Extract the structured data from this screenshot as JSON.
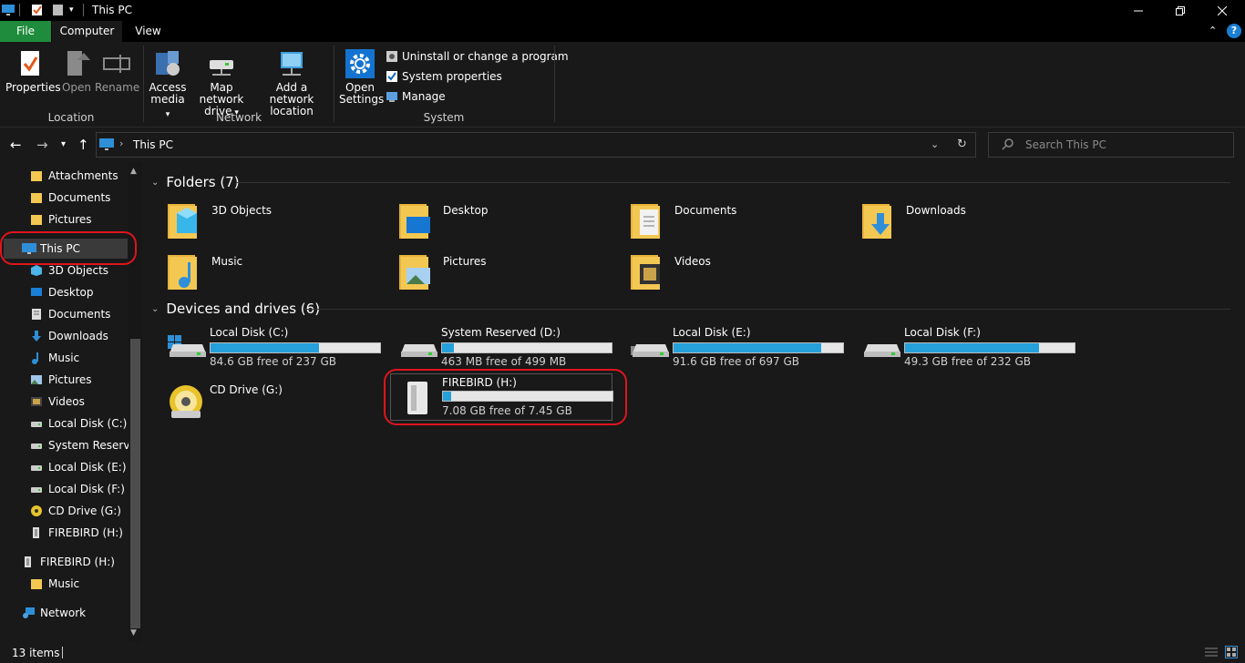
{
  "window": {
    "title": "This PC"
  },
  "ribbon_tabs": [
    {
      "label": "File",
      "active": false,
      "color": "#1e8c3c"
    },
    {
      "label": "Computer",
      "active": true
    },
    {
      "label": "View",
      "active": false
    }
  ],
  "ribbon": {
    "location": {
      "label": "Location",
      "buttons": [
        "Properties",
        "Open",
        "Rename"
      ]
    },
    "network": {
      "label": "Network",
      "access_media": [
        "Access",
        "media"
      ],
      "map_drive": [
        "Map network",
        "drive"
      ],
      "add_location": [
        "Add a network",
        "location"
      ]
    },
    "system": {
      "label": "System",
      "open_settings": [
        "Open",
        "Settings"
      ],
      "uninstall": "Uninstall or change a program",
      "properties": "System properties",
      "manage": "Manage"
    }
  },
  "address": {
    "path": "This PC"
  },
  "search": {
    "placeholder": "Search This PC"
  },
  "nav_pane": [
    {
      "label": "Attachments",
      "icon": "folder-icon",
      "indent": 1
    },
    {
      "label": "Documents",
      "icon": "folder-icon",
      "indent": 1
    },
    {
      "label": "Pictures",
      "icon": "folder-icon",
      "indent": 1
    },
    {
      "label": "This PC",
      "icon": "computer-icon",
      "indent": 0,
      "selected": true
    },
    {
      "label": "3D Objects",
      "icon": "3d-objects-icon",
      "indent": 1
    },
    {
      "label": "Desktop",
      "icon": "desktop-icon",
      "indent": 1
    },
    {
      "label": "Documents",
      "icon": "documents-icon",
      "indent": 1
    },
    {
      "label": "Downloads",
      "icon": "downloads-icon",
      "indent": 1
    },
    {
      "label": "Music",
      "icon": "music-icon",
      "indent": 1
    },
    {
      "label": "Pictures",
      "icon": "pictures-icon",
      "indent": 1
    },
    {
      "label": "Videos",
      "icon": "videos-icon",
      "indent": 1
    },
    {
      "label": "Local Disk (C:)",
      "icon": "drive-icon",
      "indent": 1
    },
    {
      "label": "System Reserved",
      "icon": "drive-icon",
      "indent": 1
    },
    {
      "label": "Local Disk (E:)",
      "icon": "drive-icon",
      "indent": 1
    },
    {
      "label": "Local Disk (F:)",
      "icon": "drive-icon",
      "indent": 1
    },
    {
      "label": "CD Drive (G:)",
      "icon": "cd-drive-icon",
      "indent": 1
    },
    {
      "label": "FIREBIRD (H:)",
      "icon": "usb-drive-icon",
      "indent": 1
    },
    {
      "label": "FIREBIRD (H:)",
      "icon": "usb-drive-icon",
      "indent": 0
    },
    {
      "label": "Music",
      "icon": "folder-icon",
      "indent": 1
    },
    {
      "label": "Network",
      "icon": "network-icon",
      "indent": 0
    }
  ],
  "folders": {
    "header": "Folders (7)",
    "items": [
      "3D Objects",
      "Desktop",
      "Documents",
      "Downloads",
      "Music",
      "Pictures",
      "Videos"
    ]
  },
  "drives": {
    "header": "Devices and drives (6)",
    "items": [
      {
        "name": "Local Disk (C:)",
        "free": "84.6 GB free of 237 GB",
        "used_fraction": 0.64
      },
      {
        "name": "System Reserved (D:)",
        "free": "463 MB free of 499 MB",
        "used_fraction": 0.07
      },
      {
        "name": "Local Disk (E:)",
        "free": "91.6 GB free of 697 GB",
        "used_fraction": 0.87
      },
      {
        "name": "Local Disk (F:)",
        "free": "49.3 GB free of 232 GB",
        "used_fraction": 0.79
      },
      {
        "name": "CD Drive (G:)",
        "free": "",
        "used_fraction": null
      },
      {
        "name": "FIREBIRD (H:)",
        "free": "7.08 GB free of 7.45 GB",
        "used_fraction": 0.05
      }
    ]
  },
  "status": {
    "items_count": "13 items"
  },
  "colors": {
    "accent": "#26a0da",
    "folder": "#f3c852",
    "highlight_annotation": "#e0141e",
    "file_tab": "#1e8c3c"
  }
}
